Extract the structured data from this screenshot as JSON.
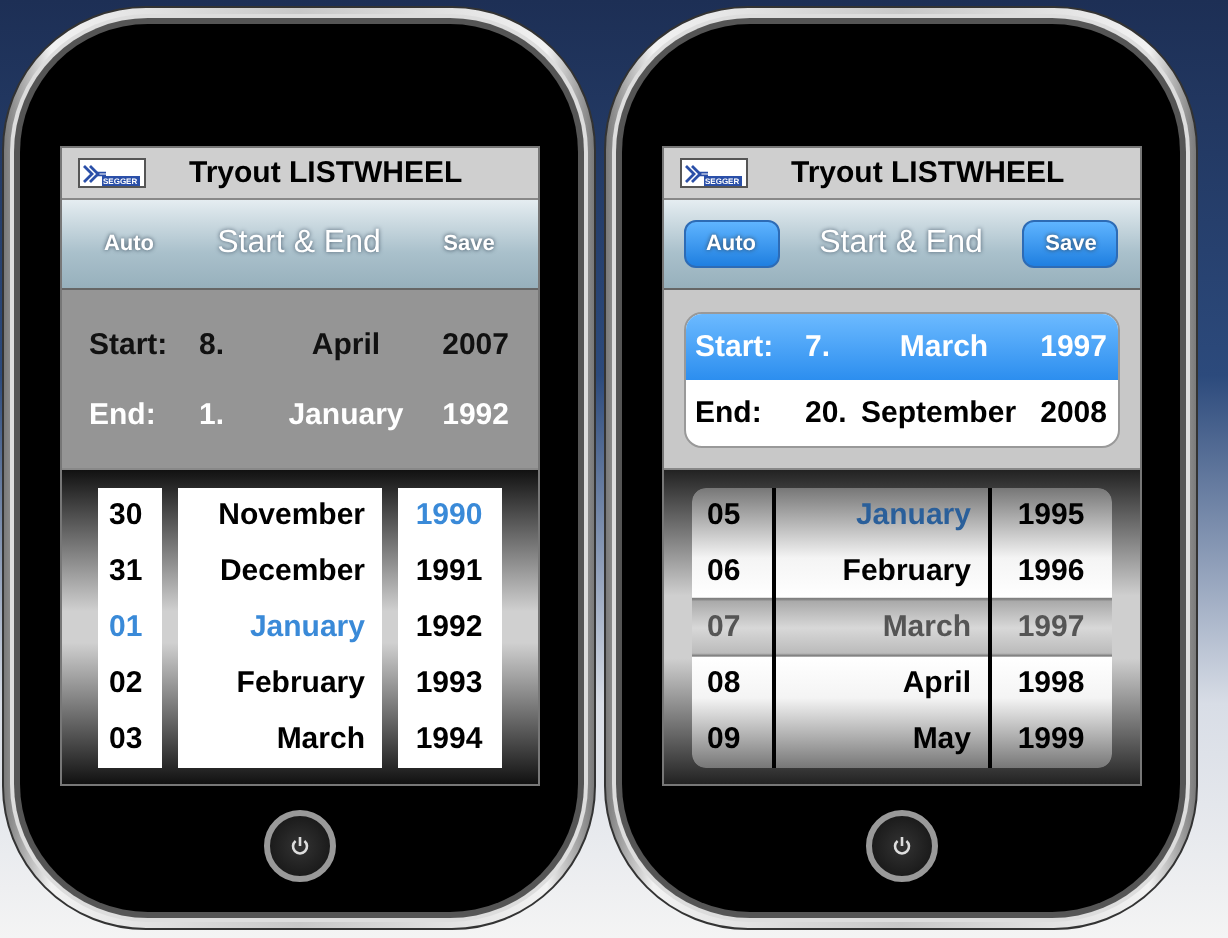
{
  "phones": [
    {
      "logo": "SEGGER",
      "title": "Tryout LISTWHEEL",
      "toolbar": {
        "kind": "flat",
        "title": "Start & End",
        "buttons": [
          "Auto",
          "Save"
        ]
      },
      "dates": [
        {
          "label": "Start:",
          "day": "8.",
          "month": "April",
          "year": "2007",
          "selected": false
        },
        {
          "label": "End:",
          "day": "1.",
          "month": "January",
          "year": "1992",
          "selected": true
        }
      ],
      "wheel": {
        "kind": "flat",
        "columns": [
          {
            "items": [
              {
                "text": "30",
                "selected": false
              },
              {
                "text": "31",
                "selected": false
              },
              {
                "text": "01",
                "selected": true
              },
              {
                "text": "02",
                "selected": false
              },
              {
                "text": "03",
                "selected": false
              }
            ]
          },
          {
            "items": [
              {
                "text": "November",
                "selected": false
              },
              {
                "text": "December",
                "selected": false
              },
              {
                "text": "January",
                "selected": true
              },
              {
                "text": "February",
                "selected": false
              },
              {
                "text": "March",
                "selected": false
              }
            ]
          },
          {
            "items": [
              {
                "text": "1990",
                "selected": true
              },
              {
                "text": "1991",
                "selected": false
              },
              {
                "text": "1992",
                "selected": false
              },
              {
                "text": "1993",
                "selected": false
              },
              {
                "text": "1994",
                "selected": false
              }
            ]
          }
        ]
      }
    },
    {
      "logo": "SEGGER",
      "title": "Tryout LISTWHEEL",
      "toolbar": {
        "kind": "skinned",
        "title": "Start & End",
        "buttons": [
          "Auto",
          "Save"
        ]
      },
      "dates": [
        {
          "label": "Start:",
          "day": "7.",
          "month": "March",
          "year": "1997",
          "selected": true
        },
        {
          "label": "End:",
          "day": "20.",
          "month": "September",
          "year": "2008",
          "selected": false
        }
      ],
      "wheel": {
        "kind": "skinned",
        "columns": [
          {
            "items": [
              {
                "text": "05",
                "selected": false
              },
              {
                "text": "06",
                "selected": false
              },
              {
                "text": "07",
                "selected": false
              },
              {
                "text": "08",
                "selected": false
              },
              {
                "text": "09",
                "selected": false
              }
            ]
          },
          {
            "items": [
              {
                "text": "January",
                "selected": true
              },
              {
                "text": "February",
                "selected": false
              },
              {
                "text": "March",
                "selected": false
              },
              {
                "text": "April",
                "selected": false
              },
              {
                "text": "May",
                "selected": false
              }
            ]
          },
          {
            "items": [
              {
                "text": "1995",
                "selected": false
              },
              {
                "text": "1996",
                "selected": false
              },
              {
                "text": "1997",
                "selected": false
              },
              {
                "text": "1998",
                "selected": false
              },
              {
                "text": "1999",
                "selected": false
              }
            ]
          }
        ]
      }
    }
  ]
}
